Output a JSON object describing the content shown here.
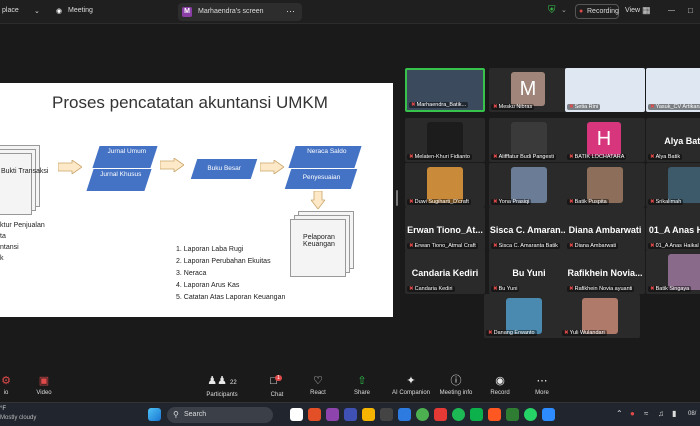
{
  "topbar": {
    "app_label": "place",
    "meeting_label": "Meeting",
    "tab_badge": "M",
    "tab_title": "Marhaendra's screen",
    "recording_label": "Recording",
    "view_label": "View"
  },
  "slide": {
    "title": "Proses pencatatan akuntansi UMKM",
    "bukti": "Bukti Transaksi",
    "jurnal_umum": "Jurnal Umum",
    "jurnal_khusus": "Jurnal Khusus",
    "buku_besar": "Buku Besar",
    "neraca_saldo": "Neraca Saldo",
    "penyesuaian": "Penyesuaian",
    "pelaporan": "Pelaporan Keuangan",
    "left_list": [
      "ktur Penjualan",
      "ta",
      "ntansi",
      "k"
    ],
    "reports": [
      "1. Laporan Laba Rugi",
      "2. Laporan Perubahan Ekuitas",
      "3. Neraca",
      "4. Laporan Arus Kas",
      "5. Catatan Atas Laporan Keuangan"
    ]
  },
  "gallery": {
    "tiles": [
      {
        "name": "Marhaendra_Batik...",
        "big": "",
        "letter": "",
        "color": "#3b4a5c"
      },
      {
        "name": "Mesku Nibras",
        "big": "",
        "letter": "M",
        "color": "#a0867a"
      },
      {
        "name": "Setia Rini",
        "big": "",
        "letter": "",
        "color": "#dfe8f2"
      },
      {
        "name": "Yasuk_CV Artikana",
        "big": "",
        "letter": "",
        "color": "#dfe8f2"
      },
      {
        "name": "Melaten-Khuri Fidianto",
        "big": "",
        "letter": "",
        "color": "#1c1c1c"
      },
      {
        "name": "Alifffatur Budi Pangesti",
        "big": "",
        "letter": "",
        "color": "#3a3a3a"
      },
      {
        "name": "BATIK LOCHATARA",
        "big": "",
        "letter": "H",
        "color": "#d7367d"
      },
      {
        "name": "Alya Batik",
        "big": "Alya Batik",
        "letter": "",
        "color": ""
      },
      {
        "name": "Duwi Sugiharti_D'craft",
        "big": "",
        "letter": "",
        "color": "#c98a3a"
      },
      {
        "name": "Yona Prasiqi",
        "big": "",
        "letter": "",
        "color": "#6a7c96"
      },
      {
        "name": "Batik Puspita",
        "big": "",
        "letter": "",
        "color": "#8d6e5a"
      },
      {
        "name": "Srikalimah",
        "big": "",
        "letter": "",
        "color": "#3d5a6a"
      },
      {
        "name": "Erwan Tiono_Atmal Craft",
        "big": "Erwan Tiono_At...",
        "letter": "",
        "color": ""
      },
      {
        "name": "Sisca C. Amaranta Batik",
        "big": "Sisca C. Amaran...",
        "letter": "",
        "color": ""
      },
      {
        "name": "Diana Ambarwati",
        "big": "Diana Ambarwati",
        "letter": "",
        "color": ""
      },
      {
        "name": "01_A Anas Haikal",
        "big": "01_A Anas Haik...",
        "letter": "",
        "color": ""
      },
      {
        "name": "Candaria Kediri",
        "big": "Candaria Kediri",
        "letter": "",
        "color": ""
      },
      {
        "name": "Bu Yuni",
        "big": "Bu Yuni",
        "letter": "",
        "color": ""
      },
      {
        "name": "Rafikhein Novia ayuanti",
        "big": "Rafikhein Novia...",
        "letter": "",
        "color": ""
      },
      {
        "name": "Batik Singaya",
        "big": "",
        "letter": "",
        "color": "#8a6a8a"
      },
      {
        "name": "Danang Erwanto",
        "big": "",
        "letter": "",
        "color": "#4a8ab0"
      },
      {
        "name": "Yuli Wulandari",
        "big": "",
        "letter": "",
        "color": "#b07a6a"
      }
    ]
  },
  "toolbar": {
    "audio": "io",
    "video": "Video",
    "participants": "Participants",
    "participants_count": "22",
    "chat": "Chat",
    "chat_badge": "1",
    "react": "React",
    "share": "Share",
    "ai": "AI Companion",
    "info": "Meeting info",
    "record": "Record",
    "more": "More"
  },
  "taskbar": {
    "weather_temp": "°F",
    "weather_text": "Mostly cloudy",
    "search_label": "Search",
    "clock": "08/"
  },
  "colors": {
    "slide_blue": "#4472c4",
    "selected_border": "#37c24c",
    "share_green": "#2ec04a",
    "record_red": "#e04a4a"
  }
}
